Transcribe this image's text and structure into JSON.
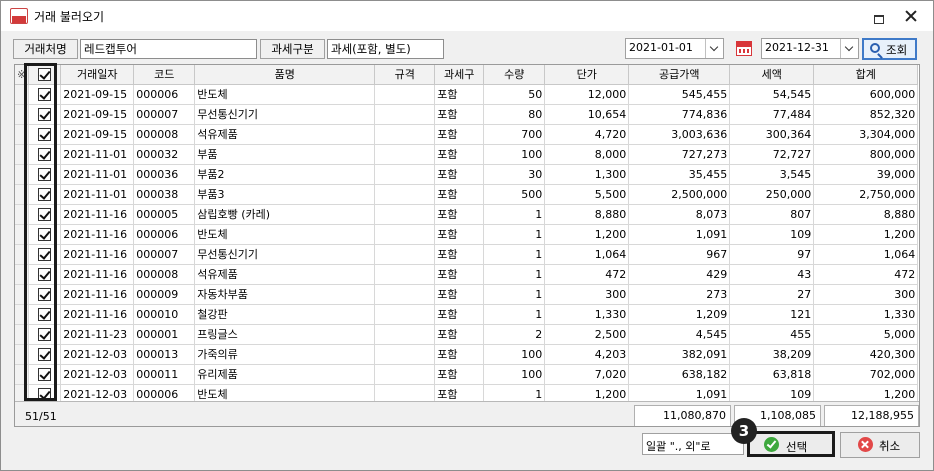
{
  "window": {
    "title": "거래 불러오기"
  },
  "filters": {
    "client_label": "거래처명",
    "client_value": "레드캡투어",
    "tax_label": "과세구분",
    "tax_value": "과세(포함, 별도)",
    "date_from": "2021-01-01",
    "date_to": "2021-12-31",
    "search_label": "조회"
  },
  "table": {
    "header_star": "※",
    "columns": [
      "거래일자",
      "코드",
      "품명",
      "규격",
      "과세구",
      "수량",
      "단가",
      "공급가액",
      "세액",
      "합계"
    ],
    "rows": [
      [
        "2021-09-15",
        "000006",
        "반도체",
        "",
        "포함",
        "50",
        "12,000",
        "545,455",
        "54,545",
        "600,000"
      ],
      [
        "2021-09-15",
        "000007",
        "무선통신기기",
        "",
        "포함",
        "80",
        "10,654",
        "774,836",
        "77,484",
        "852,320"
      ],
      [
        "2021-09-15",
        "000008",
        "석유제품",
        "",
        "포함",
        "700",
        "4,720",
        "3,003,636",
        "300,364",
        "3,304,000"
      ],
      [
        "2021-11-01",
        "000032",
        "부품",
        "",
        "포함",
        "100",
        "8,000",
        "727,273",
        "72,727",
        "800,000"
      ],
      [
        "2021-11-01",
        "000036",
        "부품2",
        "",
        "포함",
        "30",
        "1,300",
        "35,455",
        "3,545",
        "39,000"
      ],
      [
        "2021-11-01",
        "000038",
        "부품3",
        "",
        "포함",
        "500",
        "5,500",
        "2,500,000",
        "250,000",
        "2,750,000"
      ],
      [
        "2021-11-16",
        "000005",
        "삼립호빵 (카레)",
        "",
        "포함",
        "1",
        "8,880",
        "8,073",
        "807",
        "8,880"
      ],
      [
        "2021-11-16",
        "000006",
        "반도체",
        "",
        "포함",
        "1",
        "1,200",
        "1,091",
        "109",
        "1,200"
      ],
      [
        "2021-11-16",
        "000007",
        "무선통신기기",
        "",
        "포함",
        "1",
        "1,064",
        "967",
        "97",
        "1,064"
      ],
      [
        "2021-11-16",
        "000008",
        "석유제품",
        "",
        "포함",
        "1",
        "472",
        "429",
        "43",
        "472"
      ],
      [
        "2021-11-16",
        "000009",
        "자동차부품",
        "",
        "포함",
        "1",
        "300",
        "273",
        "27",
        "300"
      ],
      [
        "2021-11-16",
        "000010",
        "철강판",
        "",
        "포함",
        "1",
        "1,330",
        "1,209",
        "121",
        "1,330"
      ],
      [
        "2021-11-23",
        "000001",
        "프링글스",
        "",
        "포함",
        "2",
        "2,500",
        "4,545",
        "455",
        "5,000"
      ],
      [
        "2021-12-03",
        "000013",
        "가죽의류",
        "",
        "포함",
        "100",
        "4,203",
        "382,091",
        "38,209",
        "420,300"
      ],
      [
        "2021-12-03",
        "000011",
        "유리제품",
        "",
        "포함",
        "100",
        "7,020",
        "638,182",
        "63,818",
        "702,000"
      ],
      [
        "2021-12-03",
        "000006",
        "반도체",
        "",
        "포함",
        "1",
        "1,200",
        "1,091",
        "109",
        "1,200"
      ]
    ]
  },
  "footer": {
    "count": "51/51",
    "supply_total": "11,080,870",
    "tax_total": "1,108,085",
    "grand_total": "12,188,955"
  },
  "actions": {
    "bulk_combo": "일괄 \"., 외\"로",
    "select_label": "선택",
    "cancel_label": "취소",
    "step_badge": "3"
  }
}
